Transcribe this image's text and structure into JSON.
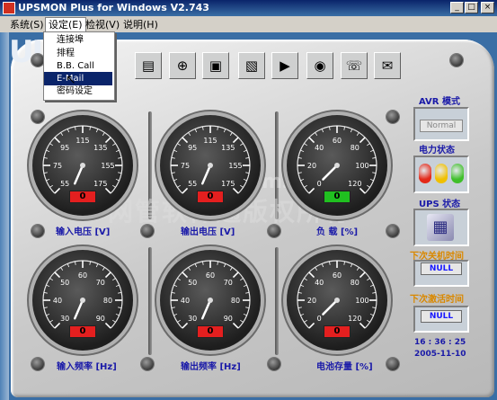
{
  "window": {
    "title": "UPSMON Plus for Windows V2.743",
    "btn_min": "_",
    "btn_max": "□",
    "btn_close": "×"
  },
  "menu": [
    {
      "label": "系统(S)"
    },
    {
      "label": "设定(E)"
    },
    {
      "label": "检视(V)"
    },
    {
      "label": "说明(H)"
    }
  ],
  "dropdown": [
    "连接埠",
    "排程",
    "B.B. Call",
    "E-Mail",
    "密码设定"
  ],
  "dropdown_selected": "E-Mail",
  "logo": "UI",
  "toolbar": [
    {
      "icon": "settings-panel-icon",
      "glyph": "▤"
    },
    {
      "icon": "add-device-icon",
      "glyph": "⊕"
    },
    {
      "icon": "network-computers-icon",
      "glyph": "▣"
    },
    {
      "icon": "display-image-icon",
      "glyph": "▧"
    },
    {
      "icon": "video-camera-icon",
      "glyph": "▶"
    },
    {
      "icon": "eye-icon",
      "glyph": "◉"
    },
    {
      "icon": "phone-icon",
      "glyph": "☏"
    },
    {
      "icon": "mail-icon",
      "glyph": "✉"
    }
  ],
  "gauges": [
    {
      "label": "输入电压 [V]",
      "ticks": [
        "55",
        "75",
        "95",
        "115",
        "135",
        "155",
        "175"
      ],
      "value": 0,
      "readout": "0",
      "readout_color": "#e41f1f"
    },
    {
      "label": "输出电压 [V]",
      "ticks": [
        "55",
        "75",
        "95",
        "115",
        "135",
        "155",
        "175"
      ],
      "value": 0,
      "readout": "0",
      "readout_color": "#e41f1f"
    },
    {
      "label": "负 载 [%]",
      "ticks": [
        "0",
        "20",
        "40",
        "60",
        "80",
        "100",
        "120"
      ],
      "value": 0,
      "readout": "0",
      "readout_color": "#20c020"
    },
    {
      "label": "输入频率 [Hz]",
      "ticks": [
        "30",
        "40",
        "50",
        "60",
        "70",
        "80",
        "90"
      ],
      "value": 0,
      "readout": "0",
      "readout_color": "#e41f1f"
    },
    {
      "label": "输出频率 [Hz]",
      "ticks": [
        "30",
        "40",
        "50",
        "60",
        "70",
        "80",
        "90"
      ],
      "value": 0,
      "readout": "0",
      "readout_color": "#e41f1f"
    },
    {
      "label": "电池存量 [%]",
      "ticks": [
        "0",
        "20",
        "40",
        "60",
        "80",
        "100",
        "120"
      ],
      "value": 0,
      "readout": "0",
      "readout_color": "#e41f1f"
    }
  ],
  "right_panel": {
    "avr_title": "AVR 模式",
    "avr_value": "Normal",
    "power_title": "电力状态",
    "ups_title": "UPS 状态",
    "next_shutdown_title": "下次关机时间",
    "next_shutdown_value": "NULL",
    "next_activate_title": "下次激活时间",
    "next_activate_value": "NULL",
    "time": "16 : 36 : 25",
    "date": "2005-11-10",
    "lights": [
      "#e32a1a",
      "#f0c000",
      "#3fbf2a"
    ]
  },
  "watermark": "网管软件通版权所有",
  "watermark2": "www.smsalert.cn"
}
